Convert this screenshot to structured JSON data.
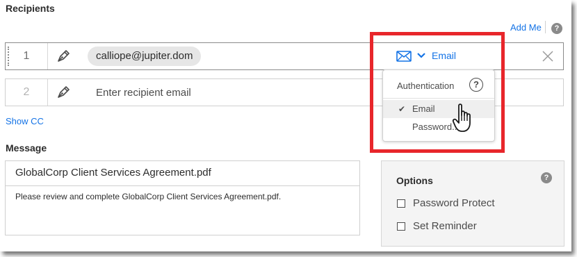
{
  "recipients": {
    "title": "Recipients",
    "add_me_label": "Add Me",
    "help_glyph": "?",
    "rows": [
      {
        "number": "1",
        "value": "calliope@jupiter.dom",
        "auth_method": "Email"
      },
      {
        "number": "2",
        "placeholder": "Enter recipient email"
      }
    ],
    "show_cc_label": "Show CC"
  },
  "auth_dropdown": {
    "header": "Authentication",
    "help_glyph": "?",
    "items": [
      {
        "label": "Email",
        "checked": true,
        "check_glyph": "✔"
      },
      {
        "label": "Password..."
      }
    ]
  },
  "message": {
    "title": "Message",
    "subject": "GlobalCorp Client Services Agreement.pdf",
    "body": "Please review and complete GlobalCorp Client Services Agreement.pdf."
  },
  "options": {
    "title": "Options",
    "help_glyph": "?",
    "items": [
      {
        "label": "Password Protect",
        "checked": false
      },
      {
        "label": "Set Reminder",
        "checked": false
      }
    ]
  },
  "icons": {
    "pen": "pen-icon",
    "mail": "mail-icon",
    "chevron": "chevron-down-icon",
    "remove": "close-icon",
    "help": "help-icon",
    "cursor": "hand-pointer-icon"
  },
  "colors": {
    "link": "#1473e6",
    "highlight": "#e8262b",
    "help_icon": "#8a8a8a"
  }
}
